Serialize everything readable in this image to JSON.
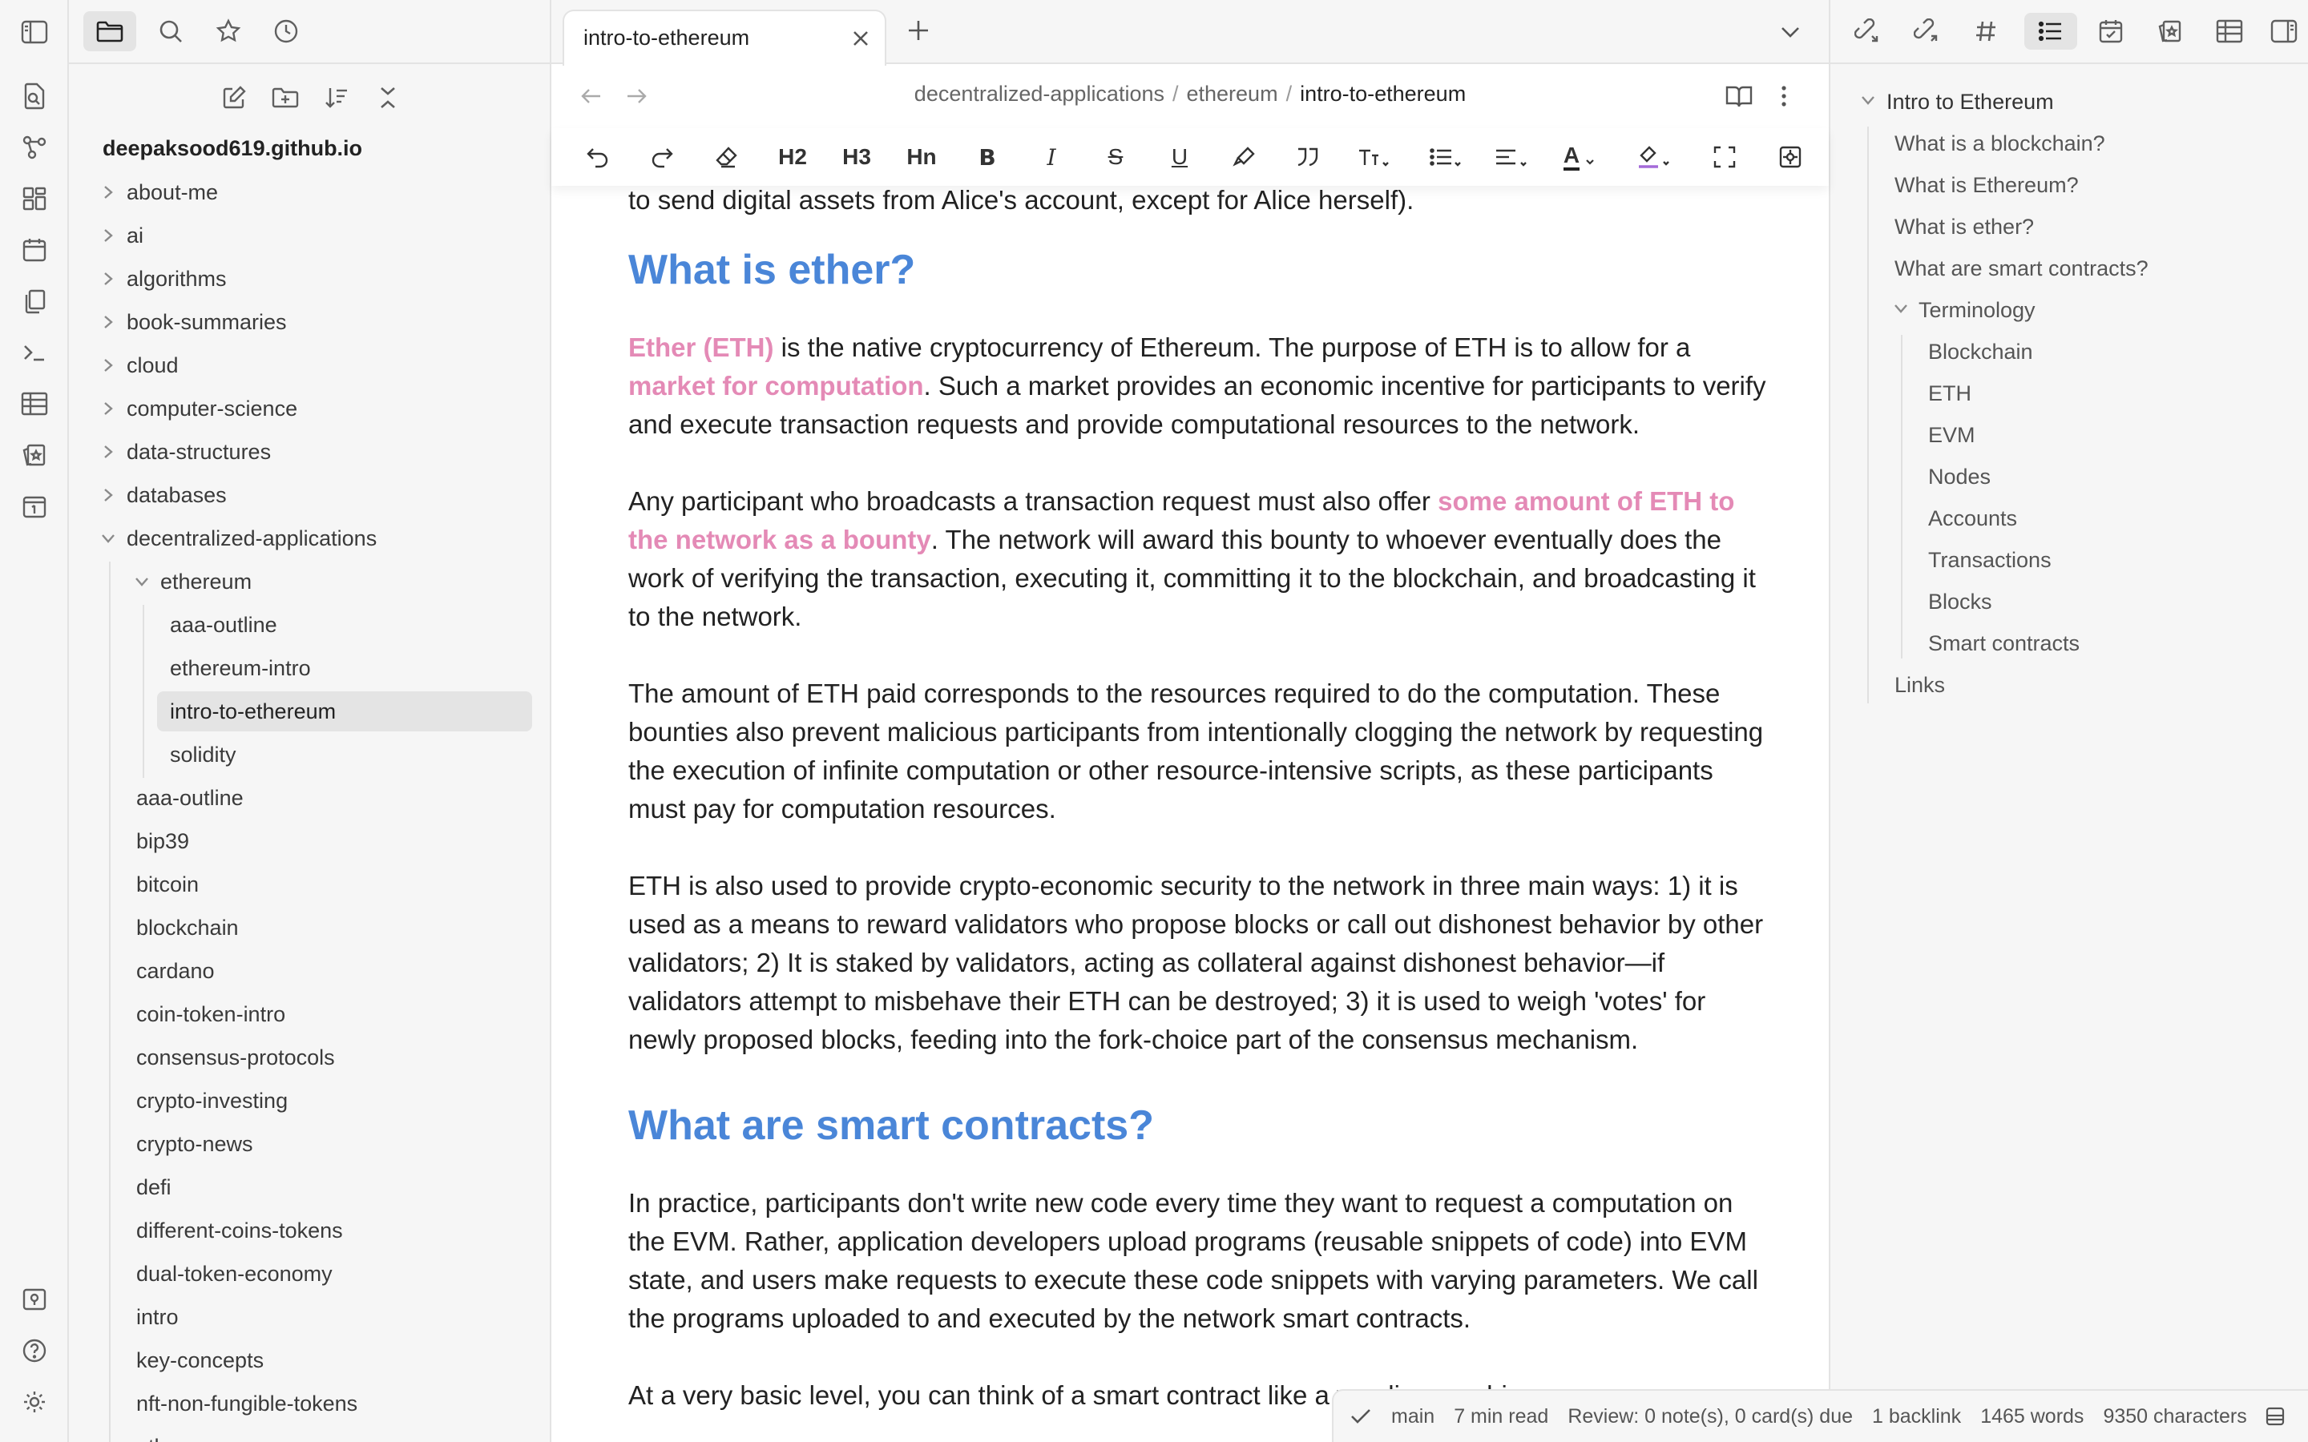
{
  "explorer": {
    "vault_name": "deepaksood619.github.io",
    "folders": [
      {
        "label": "about-me"
      },
      {
        "label": "ai"
      },
      {
        "label": "algorithms"
      },
      {
        "label": "book-summaries"
      },
      {
        "label": "cloud"
      },
      {
        "label": "computer-science"
      },
      {
        "label": "data-structures"
      },
      {
        "label": "databases"
      },
      {
        "label": "decentralized-applications"
      }
    ],
    "ethereum_folder": "ethereum",
    "ethereum_files": [
      "aaa-outline",
      "ethereum-intro",
      "intro-to-ethereum",
      "solidity"
    ],
    "dapp_files": [
      "aaa-outline",
      "bip39",
      "bitcoin",
      "blockchain",
      "cardano",
      "coin-token-intro",
      "consensus-protocols",
      "crypto-investing",
      "crypto-news",
      "defi",
      "different-coins-tokens",
      "dual-token-economy",
      "intro",
      "key-concepts",
      "nft-non-fungible-tokens",
      "others"
    ]
  },
  "tab": {
    "title": "intro-to-ethereum"
  },
  "breadcrumb": {
    "part1": "decentralized-applications",
    "part2": "ethereum",
    "part3": "intro-to-ethereum",
    "sep": "/"
  },
  "toolbar": {
    "h2": "H2",
    "h3": "H3",
    "hn": "Hn",
    "bold": "B",
    "italic": "I",
    "strike": "S",
    "underline": "U",
    "text_color": "A"
  },
  "doc": {
    "p0": "to send digital assets from Alice's account, except for Alice herself).",
    "h_ether": "What is ether?",
    "p1_hl1": "Ether (ETH)",
    "p1_a": " is the native cryptocurrency of Ethereum. The purpose of ETH is to allow for a ",
    "p1_hl2": "market for computation",
    "p1_b": ". Such a market provides an economic incentive for participants to verify and execute transaction requests and provide computational resources to the network.",
    "p2_a": "Any participant who broadcasts a transaction request must also offer ",
    "p2_hl": "some amount of ETH to the network as a bounty",
    "p2_b": ". The network will award this bounty to whoever eventually does the work of verifying the transaction, executing it, committing it to the blockchain, and broadcasting it to the network.",
    "p3": "The amount of ETH paid corresponds to the resources required to do the computation. These bounties also prevent malicious participants from intentionally clogging the network by requesting the execution of infinite computation or other resource-intensive scripts, as these participants must pay for computation resources.",
    "p4": "ETH is also used to provide crypto-economic security to the network in three main ways: 1) it is used as a means to reward validators who propose blocks or call out dishonest behavior by other validators; 2) It is staked by validators, acting as collateral against dishonest behavior—if validators attempt to misbehave their ETH can be destroyed; 3) it is used to weigh 'votes' for newly proposed blocks, feeding into the fork-choice part of the consensus mechanism.",
    "h_contracts": "What are smart contracts?",
    "p5": "In practice, participants don't write new code every time they want to request a computation on the EVM. Rather, application developers upload programs (reusable snippets of code) into EVM state, and users make requests to execute these code snippets with varying parameters. We call the programs uploaded to and executed by the network smart contracts.",
    "p6": "At a very basic level, you can think of a smart contract like a vending machine"
  },
  "status": {
    "branch": "main",
    "read_time": "7 min read",
    "review": "Review: 0 note(s), 0 card(s) due",
    "backlinks": "1 backlink",
    "words": "1465 words",
    "characters": "9350 characters"
  },
  "outline": {
    "root": "Intro to Ethereum",
    "items": [
      "What is a blockchain?",
      "What is Ethereum?",
      "What is ether?",
      "What are smart contracts?"
    ],
    "terminology": "Terminology",
    "terms": [
      "Blockchain",
      "ETH",
      "EVM",
      "Nodes",
      "Accounts",
      "Transactions",
      "Blocks",
      "Smart contracts"
    ],
    "links": "Links"
  },
  "colors": {
    "heading": "#4a86d8",
    "highlight": "#e48ab6",
    "selected_row": "#e4e4e4",
    "sidebar_bg": "#f6f6f6"
  }
}
